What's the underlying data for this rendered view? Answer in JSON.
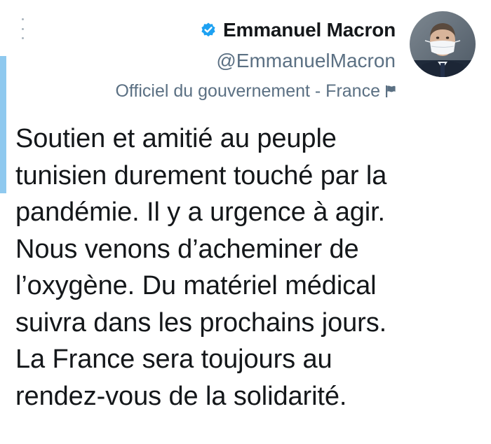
{
  "tweet": {
    "author": {
      "display_name": "Emmanuel Macron",
      "handle": "@EmmanuelMacron",
      "verified": true,
      "label": "Officiel du gouvernement - France",
      "avatar_icon": "profile-photo"
    },
    "text": "Soutien et amitié au peuple\ntunisien durement touché par la\npandémie. Il y a urgence à agir.\nNous venons d’acheminer de\nl’oxygène. Du matériel médical\nsuivra dans les prochains jours.\nLa France sera toujours au\nrendez-vous de la solidarité."
  },
  "icons": {
    "menu": "more-vertical-icon",
    "verified": "verified-badge-icon",
    "label_flag": "flag-icon"
  },
  "colors": {
    "accent_bar": "#8fc9ef",
    "verified_blue": "#1da1f2",
    "text_primary": "#14171a",
    "text_secondary": "#5b7083"
  }
}
